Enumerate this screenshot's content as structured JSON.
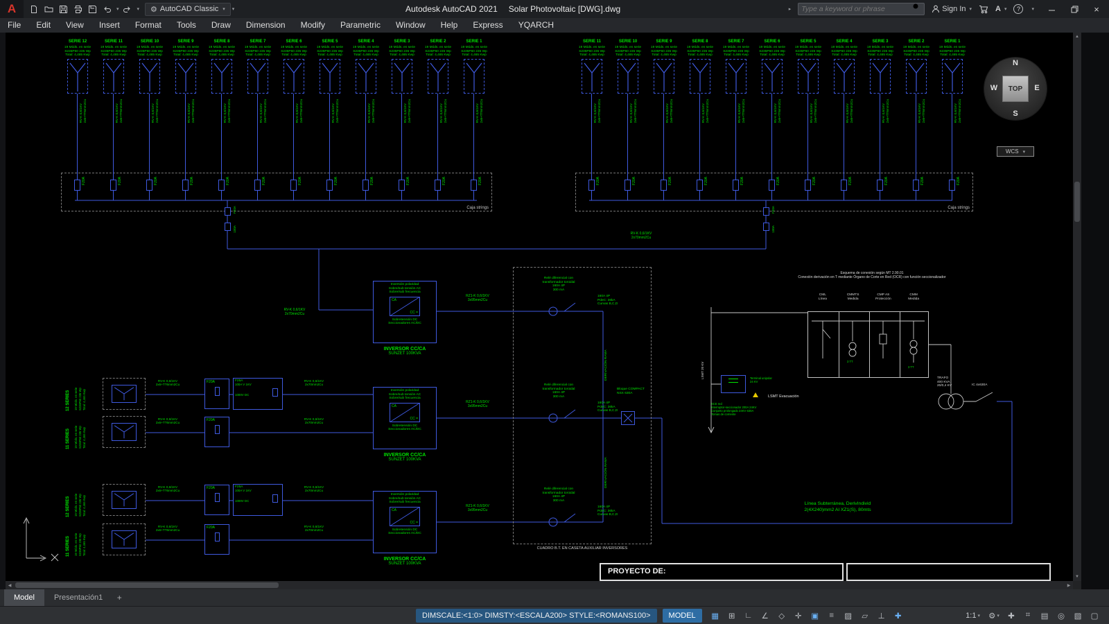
{
  "titlebar": {
    "app_title": "Autodesk AutoCAD 2021",
    "doc_title": "Solar Photovoltaic [DWG].dwg",
    "workspace": "AutoCAD Classic",
    "search_placeholder": "Type a keyword or phrase",
    "sign_in_label": "Sign In"
  },
  "menu": [
    "File",
    "Edit",
    "View",
    "Insert",
    "Format",
    "Tools",
    "Draw",
    "Dimension",
    "Modify",
    "Parametric",
    "Window",
    "Help",
    "Express",
    "YQARCH"
  ],
  "tabs": {
    "model": "Model",
    "layout1": "Presentación1",
    "add": "+"
  },
  "statusbar": {
    "dim_fields": "DIMSCALE:<1:0> DIMSTY:<ESCALA200> STYLE:<ROMANS100>",
    "model_label": "MODEL",
    "annotation_scale": "1:1",
    "icons": [
      {
        "name": "grid-icon",
        "glyph": "▦",
        "state": "on"
      },
      {
        "name": "snap-mode-icon",
        "glyph": "⊞",
        "state": "off"
      },
      {
        "name": "ortho-mode-icon",
        "glyph": "∟",
        "state": "off"
      },
      {
        "name": "polar-tracking-icon",
        "glyph": "∠",
        "state": "off"
      },
      {
        "name": "isometric-drafting-icon",
        "glyph": "◇",
        "state": "off"
      },
      {
        "name": "object-snap-tracking-icon",
        "glyph": "✛",
        "state": "off"
      },
      {
        "name": "object-snap-icon",
        "glyph": "▣",
        "state": "on"
      },
      {
        "name": "lineweight-icon",
        "glyph": "≡",
        "state": "off"
      },
      {
        "name": "transparency-icon",
        "glyph": "▨",
        "state": "off"
      },
      {
        "name": "selection-cycling-icon",
        "glyph": "▱",
        "state": "off"
      },
      {
        "name": "dynamic-ucs-icon",
        "glyph": "⊥",
        "state": "off"
      },
      {
        "name": "dynamic-input-icon",
        "glyph": "✚",
        "state": "on"
      }
    ],
    "right_icons": [
      {
        "name": "annotation-monitor-icon",
        "glyph": "✚",
        "state": "off"
      },
      {
        "name": "units-icon",
        "glyph": "⌗",
        "state": "off"
      },
      {
        "name": "quick-properties-icon",
        "glyph": "▤",
        "state": "off"
      },
      {
        "name": "isolate-objects-icon",
        "glyph": "◎",
        "state": "off"
      },
      {
        "name": "graphics-performance-icon",
        "glyph": "▧",
        "state": "off"
      },
      {
        "name": "clean-screen-icon",
        "glyph": "▢",
        "state": "off"
      }
    ]
  },
  "drawing": {
    "colors": {
      "line_blue": "#3f5ae0",
      "text_green": "#00e400",
      "dim_gray": "#c8c8c8"
    },
    "strings_left": {
      "series": [
        "SERIE 12",
        "SERIE 11",
        "SERIE 10",
        "SERIE 9",
        "SERIE 8",
        "SERIE 7",
        "SERIE 6",
        "SERIE 5",
        "SERIE 4",
        "SERIE 3",
        "SERIE 2",
        "SERIE 1"
      ],
      "box_label": "Caja strings"
    },
    "strings_right": {
      "series": [
        "SERIE 11",
        "SERIE 10",
        "SERIE 9",
        "SERIE 8",
        "SERIE 7",
        "SERIE 6",
        "SERIE 5",
        "SERIE 4",
        "SERIE 3",
        "SERIE 2",
        "SERIE 1"
      ],
      "box_label": "Caja strings"
    },
    "string_shared": {
      "info": [
        "19 Móds. en serie",
        "S235P60 235 Wp",
        "Total: 4,465 Kwp"
      ],
      "cable": [
        "RV-K 0,6/1KV",
        "2x6+TT6mm2Cu"
      ],
      "fuse": "F20A"
    },
    "junction_labels": [
      "F20A",
      "100A"
    ],
    "cables": {
      "dc_main": [
        "RV-K 0,6/1KV",
        "2x70mm2Cu"
      ],
      "ac_inverter": [
        "RZ1-K 0,6/1KV",
        "3x95mm2Cu"
      ]
    },
    "inverter": {
      "protection_top": [
        "Inversión polaridad",
        "Sobre/sub tensión AC",
        "Sobre/sub frecuencia"
      ],
      "ca": "CA",
      "cc": "CC =",
      "protection_bottom": [
        "Sobretensión DC",
        "Seccionadores AC/DC"
      ],
      "title": "INVERSOR CC/CA",
      "model": "SUNZET 100KVA"
    },
    "inverters": [
      "inversor-1",
      "inversor-2",
      "inversor-3"
    ],
    "pv_rows": [
      {
        "label": "12 SERIES"
      },
      {
        "label": "11 SERIES"
      },
      {
        "label": "12 SERIES"
      },
      {
        "label": "11 SERIES"
      }
    ],
    "pv_row_shared": {
      "cluster": [
        "F25A",
        "100A V 1KV",
        "1000V DC"
      ]
    },
    "cuadro": {
      "relays": [
        "rama-1",
        "rama-2",
        "rama-3"
      ],
      "relay_lines": [
        "Relé diferencial con",
        "transformador toroidal",
        "160A 4P",
        "300 mA"
      ],
      "breaker_lines": [
        "160A 4P",
        "PdeC: 36kA",
        "Curvas B,C,D"
      ],
      "derivacion": "DERIVACIÓN RAMA",
      "bloque": [
        "Bloque COMPACT",
        "NSX 630A"
      ],
      "label": "CUADRO B.T. EN CASETA AUXILIAR INVERSORES"
    },
    "mv": {
      "esquema": [
        "Esquema de conexión según MT 2.90.01",
        "Conexión derivación en T mediante Órgano de Corte en Red (OCR) con función seccionalizador"
      ],
      "cells": [
        {
          "name": "CML",
          "role": "Línea"
        },
        {
          "name": "CMMTS",
          "role": "Medida"
        },
        {
          "name": "CMP AS",
          "role": "Protección"
        },
        {
          "name": "CMM",
          "role": "Medida"
        }
      ],
      "tt": "3 TT",
      "feeder": "LSMT 20 KV",
      "terminal": [
        "Terminal unipolar",
        "24 KV"
      ],
      "sce": [
        "SCE red",
        "Interruptor-seccionador 200A 24KV",
        "Conjunto prolongado 24KV 630A",
        "Tomas de corriente"
      ],
      "lsmt": "LSMT Evacuación",
      "trafo": [
        "TRAFO",
        "400 KVA",
        "20/0,4 KV"
      ],
      "ic": "IC 4x630A",
      "linea": [
        "Línea Subterránea, DerivIndivid",
        "2(4X240)mm2 Al XZ1(S), 80mts"
      ]
    },
    "titleblock": {
      "proyecto": "PROYECTO DE:"
    },
    "navwheel": {
      "n": "N",
      "w": "W",
      "e": "E",
      "s": "S",
      "top": "TOP",
      "wcs": "WCS"
    }
  }
}
